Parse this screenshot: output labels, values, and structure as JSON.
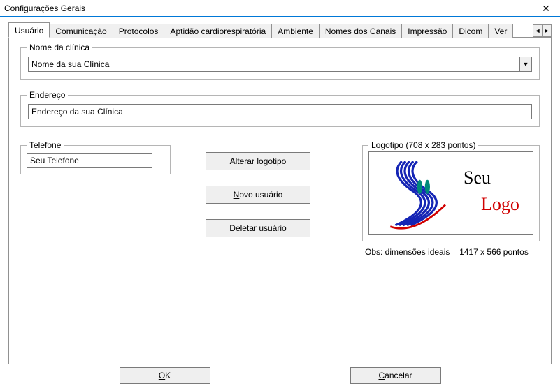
{
  "window": {
    "title": "Configurações Gerais",
    "close_icon": "✕"
  },
  "tabs": [
    "Usuário",
    "Comunicação",
    "Protocolos",
    "Aptidão cardiorespiratória",
    "Ambiente",
    "Nomes dos Canais",
    "Impressão",
    "Dicom",
    "Ver"
  ],
  "active_tab_index": 0,
  "tab_arrows": {
    "left": "◄",
    "right": "►"
  },
  "groups": {
    "clinic": {
      "legend": "Nome da clínica",
      "value": "Nome da sua Clínica",
      "dropdown_icon": "▼"
    },
    "address": {
      "legend": "Endereço",
      "value": "Endereço da sua Clínica"
    },
    "phone": {
      "legend": "Telefone",
      "value": "Seu Telefone"
    },
    "logo": {
      "legend": "Logotipo   (708 x 283 pontos)",
      "text_top": "Seu",
      "text_bottom": "Logo",
      "note": "Obs: dimensões ideais = 1417 x 566  pontos"
    }
  },
  "buttons": {
    "change_logo": {
      "pre": "Alterar ",
      "u": "l",
      "post": "ogotipo"
    },
    "new_user": {
      "pre": "",
      "u": "N",
      "post": "ovo usuário"
    },
    "delete_user": {
      "pre": "",
      "u": "D",
      "post": "eletar usuário"
    },
    "ok": {
      "pre": "",
      "u": "O",
      "post": "K"
    },
    "cancel": {
      "pre": "",
      "u": "C",
      "post": "ancelar"
    }
  }
}
